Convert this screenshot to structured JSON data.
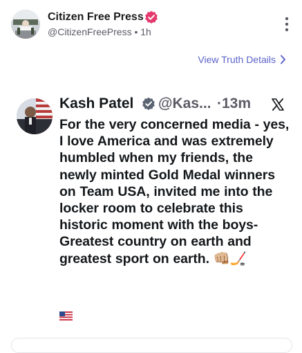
{
  "post": {
    "author_name": "Citizen Free Press",
    "author_handle": "@CitizenFreePress",
    "separator": "•",
    "time": "1h",
    "view_details_label": "View Truth Details"
  },
  "quoted": {
    "name": "Kash Patel",
    "handle": "@Kas...",
    "separator": "·",
    "time": "13m",
    "text": "For the very concerned media - yes, I love America and was extremely humbled when my friends, the newly minted Gold Medal winners on Team USA, invited me into the locker room to celebrate this historic moment with the boys- Greatest country on earth and greatest sport on earth. 👊🏼🏒"
  },
  "colors": {
    "verified_badge": "#e5396d",
    "link": "#5b63c9",
    "muted_text": "#5b5b66",
    "quote_badge": "#5b6472"
  },
  "icons": {
    "verified": "verified-badge-icon",
    "more": "more-vertical-icon",
    "chevron": "chevron-right-icon",
    "x_logo": "x-logo-icon",
    "flag": "us-flag-icon"
  }
}
